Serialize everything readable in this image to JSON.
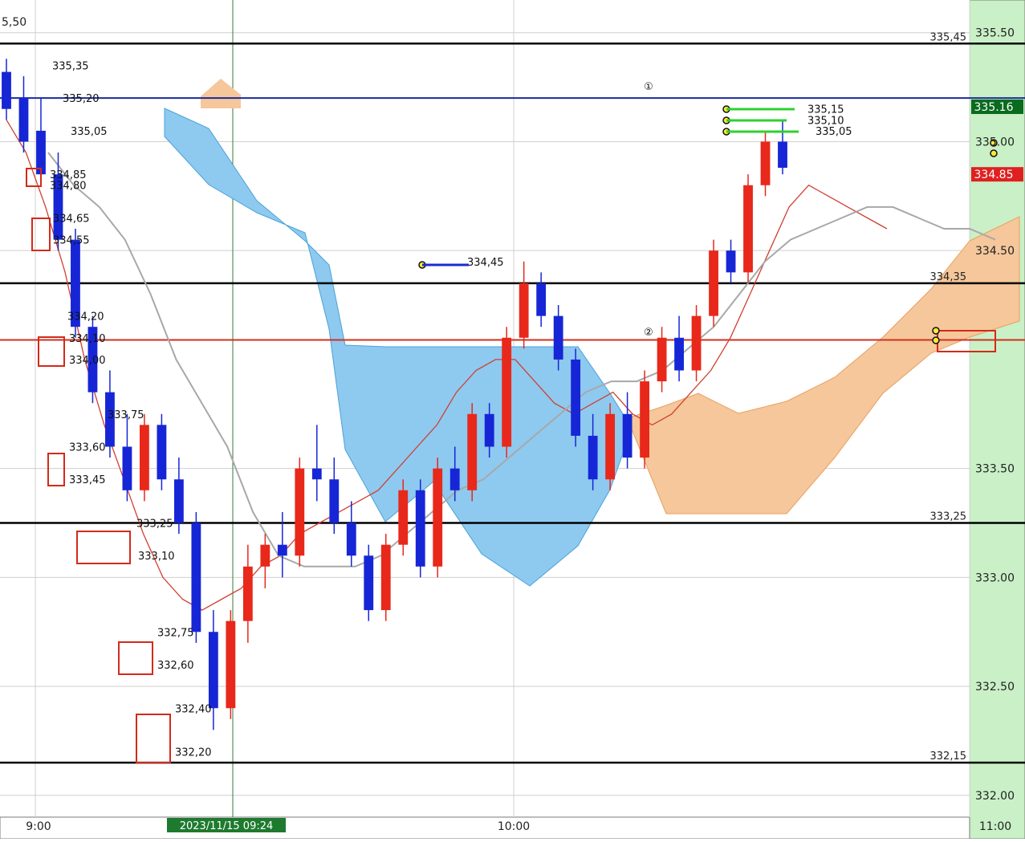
{
  "chart_data": {
    "type": "candlestick",
    "y_axis": {
      "range": [
        331.9,
        335.65
      ],
      "tick_labels": [
        "335.50",
        "335.00",
        "334.50",
        "333.50",
        "333.00",
        "332.50",
        "332.00"
      ],
      "tick_values": [
        335.5,
        335.0,
        334.5,
        333.5,
        333.0,
        332.5,
        332.0
      ],
      "top_partial_label": "5,50"
    },
    "x_axis": {
      "tick_labels": [
        "9:00",
        "10:00",
        "11:00"
      ],
      "crosshair_time": "2023/11/15 09:24"
    },
    "price_tags": [
      {
        "label": "335.16",
        "value": 335.16,
        "color": "#0a6b1e"
      },
      {
        "label": "334.85",
        "value": 334.85,
        "color": "#e02020"
      }
    ],
    "horizontal_levels": [
      {
        "label": "335,45",
        "value": 335.45,
        "color": "#000000"
      },
      {
        "label": "334,35",
        "value": 334.35,
        "color": "#000000"
      },
      {
        "label": "333,25",
        "value": 333.25,
        "color": "#000000"
      },
      {
        "label": "332,15",
        "value": 332.15,
        "color": "#000000"
      },
      {
        "label": "",
        "value": 335.2,
        "color": "#1a2b9a"
      },
      {
        "label": "",
        "value": 334.09,
        "color": "#d03020"
      }
    ],
    "annotations": [
      {
        "text": "335,35",
        "value": 335.35
      },
      {
        "text": "335,20",
        "value": 335.2
      },
      {
        "text": "335,05",
        "value": 335.05
      },
      {
        "text": "334,85",
        "value": 334.85
      },
      {
        "text": "334,80",
        "value": 334.8
      },
      {
        "text": "334,65",
        "value": 334.65
      },
      {
        "text": "334,55",
        "value": 334.55
      },
      {
        "text": "334,20",
        "value": 334.2
      },
      {
        "text": "334,10",
        "value": 334.1
      },
      {
        "text": "334,00",
        "value": 334.0
      },
      {
        "text": "333,75",
        "value": 333.75
      },
      {
        "text": "333,60",
        "value": 333.6
      },
      {
        "text": "333,45",
        "value": 333.45
      },
      {
        "text": "333,25",
        "value": 333.25
      },
      {
        "text": "333,10",
        "value": 333.1
      },
      {
        "text": "332,75",
        "value": 332.75
      },
      {
        "text": "332,60",
        "value": 332.6
      },
      {
        "text": "332,40",
        "value": 332.4
      },
      {
        "text": "332,20",
        "value": 332.2
      },
      {
        "text": "334,45",
        "value": 334.45
      },
      {
        "text": "335,15",
        "value": 335.15
      },
      {
        "text": "335,10",
        "value": 335.1
      },
      {
        "text": "335,05",
        "value": 335.05
      }
    ],
    "markers": [
      "①",
      "②"
    ],
    "series": [
      {
        "name": "",
        "type": "candles",
        "comment": "open/high/low/close per bar",
        "ohlc": [
          [
            335.32,
            335.38,
            335.1,
            335.15
          ],
          [
            335.2,
            335.3,
            334.95,
            335.0
          ],
          [
            335.05,
            335.2,
            334.8,
            334.85
          ],
          [
            334.85,
            334.95,
            334.5,
            334.55
          ],
          [
            334.55,
            334.6,
            334.1,
            334.15
          ],
          [
            334.15,
            334.2,
            333.8,
            333.85
          ],
          [
            333.85,
            333.95,
            333.55,
            333.6
          ],
          [
            333.6,
            333.75,
            333.35,
            333.4
          ],
          [
            333.4,
            333.75,
            333.35,
            333.7
          ],
          [
            333.7,
            333.75,
            333.4,
            333.45
          ],
          [
            333.45,
            333.55,
            333.2,
            333.25
          ],
          [
            333.25,
            333.3,
            332.7,
            332.75
          ],
          [
            332.75,
            332.85,
            332.3,
            332.4
          ],
          [
            332.4,
            332.85,
            332.35,
            332.8
          ],
          [
            332.8,
            333.15,
            332.7,
            333.05
          ],
          [
            333.05,
            333.2,
            332.95,
            333.15
          ],
          [
            333.15,
            333.3,
            333.0,
            333.1
          ],
          [
            333.1,
            333.55,
            333.05,
            333.5
          ],
          [
            333.5,
            333.7,
            333.35,
            333.45
          ],
          [
            333.45,
            333.55,
            333.2,
            333.25
          ],
          [
            333.25,
            333.35,
            333.05,
            333.1
          ],
          [
            333.1,
            333.15,
            332.8,
            332.85
          ],
          [
            332.85,
            333.2,
            332.8,
            333.15
          ],
          [
            333.15,
            333.45,
            333.1,
            333.4
          ],
          [
            333.4,
            333.45,
            333.0,
            333.05
          ],
          [
            333.05,
            333.55,
            333.0,
            333.5
          ],
          [
            333.5,
            333.6,
            333.35,
            333.4
          ],
          [
            333.4,
            333.8,
            333.35,
            333.75
          ],
          [
            333.75,
            333.8,
            333.55,
            333.6
          ],
          [
            333.6,
            334.15,
            333.55,
            334.1
          ],
          [
            334.1,
            334.45,
            334.05,
            334.35
          ],
          [
            334.35,
            334.4,
            334.15,
            334.2
          ],
          [
            334.2,
            334.25,
            333.95,
            334.0
          ],
          [
            334.0,
            334.05,
            333.6,
            333.65
          ],
          [
            333.65,
            333.75,
            333.4,
            333.45
          ],
          [
            333.45,
            333.8,
            333.4,
            333.75
          ],
          [
            333.75,
            333.85,
            333.5,
            333.55
          ],
          [
            333.55,
            333.95,
            333.5,
            333.9
          ],
          [
            333.9,
            334.15,
            333.85,
            334.1
          ],
          [
            334.1,
            334.2,
            333.9,
            333.95
          ],
          [
            333.95,
            334.25,
            333.9,
            334.2
          ],
          [
            334.2,
            334.55,
            334.15,
            334.5
          ],
          [
            334.5,
            334.55,
            334.35,
            334.4
          ],
          [
            334.4,
            334.85,
            334.35,
            334.8
          ],
          [
            334.8,
            335.05,
            334.75,
            335.0
          ],
          [
            335.0,
            335.1,
            334.85,
            334.88
          ]
        ]
      },
      {
        "name": "",
        "type": "line",
        "color": "#d04030",
        "values": [
          335.1,
          334.95,
          334.7,
          334.4,
          334.0,
          333.7,
          333.45,
          333.2,
          333.0,
          332.9,
          332.85,
          332.9,
          332.95,
          333.05,
          333.1,
          333.2,
          333.25,
          333.3,
          333.35,
          333.4,
          333.5,
          333.6,
          333.7,
          333.85,
          333.95,
          334.0,
          334.0,
          333.9,
          333.8,
          333.75,
          333.8,
          333.85,
          333.75,
          333.7,
          333.75,
          333.85,
          333.95,
          334.1,
          334.3,
          334.5,
          334.7,
          334.8,
          334.75,
          334.7,
          334.65,
          334.6
        ]
      },
      {
        "name": "",
        "type": "line",
        "color": "#a8a8a8",
        "values": [
          334.95,
          334.8,
          334.7,
          334.55,
          334.3,
          334.0,
          333.8,
          333.6,
          333.3,
          333.1,
          333.05,
          333.05,
          333.05,
          333.1,
          333.2,
          333.3,
          333.4,
          333.45,
          333.55,
          333.65,
          333.75,
          333.85,
          333.9,
          333.9,
          333.95,
          334.05,
          334.15,
          334.3,
          334.45,
          334.55,
          334.6,
          334.65,
          334.7,
          334.7,
          334.65,
          334.6,
          334.6,
          334.55
        ]
      }
    ],
    "cloud": [
      {
        "name": "",
        "color": "#8ec9f0",
        "x_range": [
          0.16,
          0.62
        ],
        "comment": "bearish kumo"
      },
      {
        "name": "",
        "color": "#f5c79b",
        "x_range": [
          0.64,
          1.0
        ],
        "comment": "bullish kumo"
      }
    ],
    "grid": true,
    "background_right_panel": "#c9f0c6"
  }
}
